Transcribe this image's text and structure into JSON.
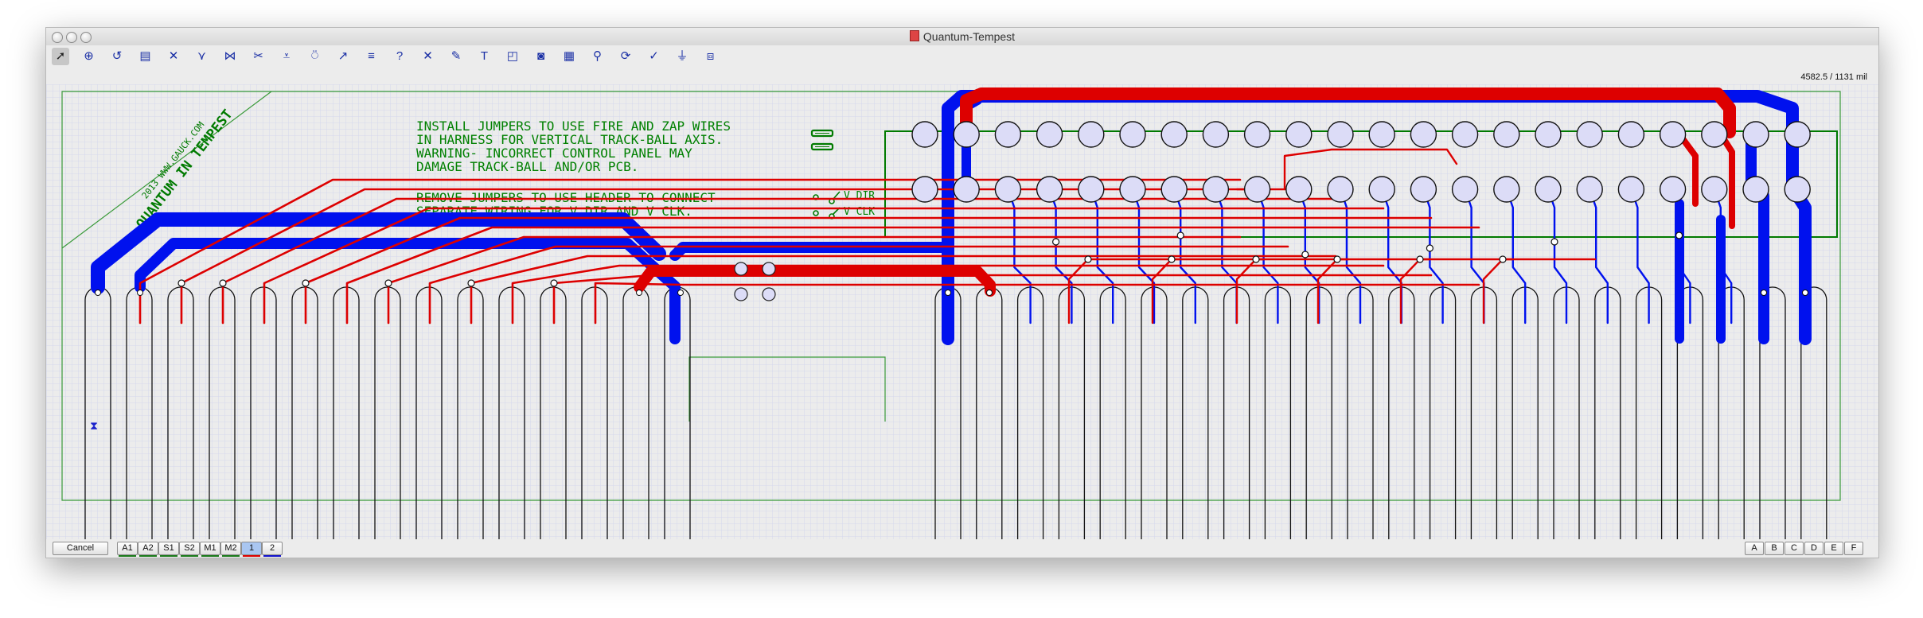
{
  "window": {
    "title": "Quantum-Tempest",
    "coord_readout": "4582.5 / 1131  mil"
  },
  "toolbar": {
    "tools": [
      {
        "name": "select-tool-icon",
        "glyph": "➚"
      },
      {
        "name": "zoom-tool-icon",
        "glyph": "⊕"
      },
      {
        "name": "rotate-tool-icon",
        "glyph": "↺"
      },
      {
        "name": "label-tool-icon",
        "glyph": "▤"
      },
      {
        "name": "trace-tool-icon",
        "glyph": "✕"
      },
      {
        "name": "via-tool-icon",
        "glyph": "⋎"
      },
      {
        "name": "route-tool-icon",
        "glyph": "⋈"
      },
      {
        "name": "split-tool-icon",
        "glyph": "✂"
      },
      {
        "name": "pad-tool-icon",
        "glyph": "⩡"
      },
      {
        "name": "hole-tool-icon",
        "glyph": "⍥"
      },
      {
        "name": "arc-tool-icon",
        "glyph": "↗"
      },
      {
        "name": "bus-tool-icon",
        "glyph": "≡"
      },
      {
        "name": "help-tool-icon",
        "glyph": "?"
      },
      {
        "name": "delete-tool-icon",
        "glyph": "✕"
      },
      {
        "name": "pencil-tool-icon",
        "glyph": "✎"
      },
      {
        "name": "text-tool-icon",
        "glyph": "T"
      },
      {
        "name": "corner-tool-icon",
        "glyph": "◰"
      },
      {
        "name": "target-tool-icon",
        "glyph": "◙"
      },
      {
        "name": "grid-tool-icon",
        "glyph": "▦"
      },
      {
        "name": "probe-tool-icon",
        "glyph": "⚲"
      },
      {
        "name": "refresh-tool-icon",
        "glyph": "⟳"
      },
      {
        "name": "check-tool-icon",
        "glyph": "✓"
      },
      {
        "name": "ground-tool-icon",
        "glyph": "⏚"
      },
      {
        "name": "chip-tool-icon",
        "glyph": "⧈"
      }
    ]
  },
  "board": {
    "logo_lines": [
      "QUANTUM IN TEMPEST",
      "2013 WWW.GAUCK.COM"
    ],
    "notes_top": [
      "INSTALL JUMPERS TO USE FIRE AND ZAP WIRES",
      "IN HARNESS FOR VERTICAL TRACK-BALL AXIS.",
      "WARNING- INCORRECT CONTROL PANEL MAY",
      "DAMAGE TRACK-BALL AND/OR PCB."
    ],
    "notes_bottom": [
      "REMOVE JUMPERS TO USE HEADER TO CONNECT",
      "SEPARATE WIRING FOR V DIR AND V CLK."
    ],
    "header_labels": [
      "V DIR",
      "V CLK"
    ],
    "colors": {
      "top_trace": "#dd0000",
      "bottom_trace": "#0011ee",
      "silkscreen": "#007a00",
      "grid": "#cfd3ee",
      "pad_fill": "#dcdcf7"
    }
  },
  "statusbar": {
    "cancel_label": "Cancel",
    "layers": [
      "A1",
      "A2",
      "S1",
      "S2",
      "M1",
      "M2",
      "1",
      "2"
    ],
    "right_buttons": [
      "A",
      "B",
      "C",
      "D",
      "E",
      "F"
    ]
  }
}
